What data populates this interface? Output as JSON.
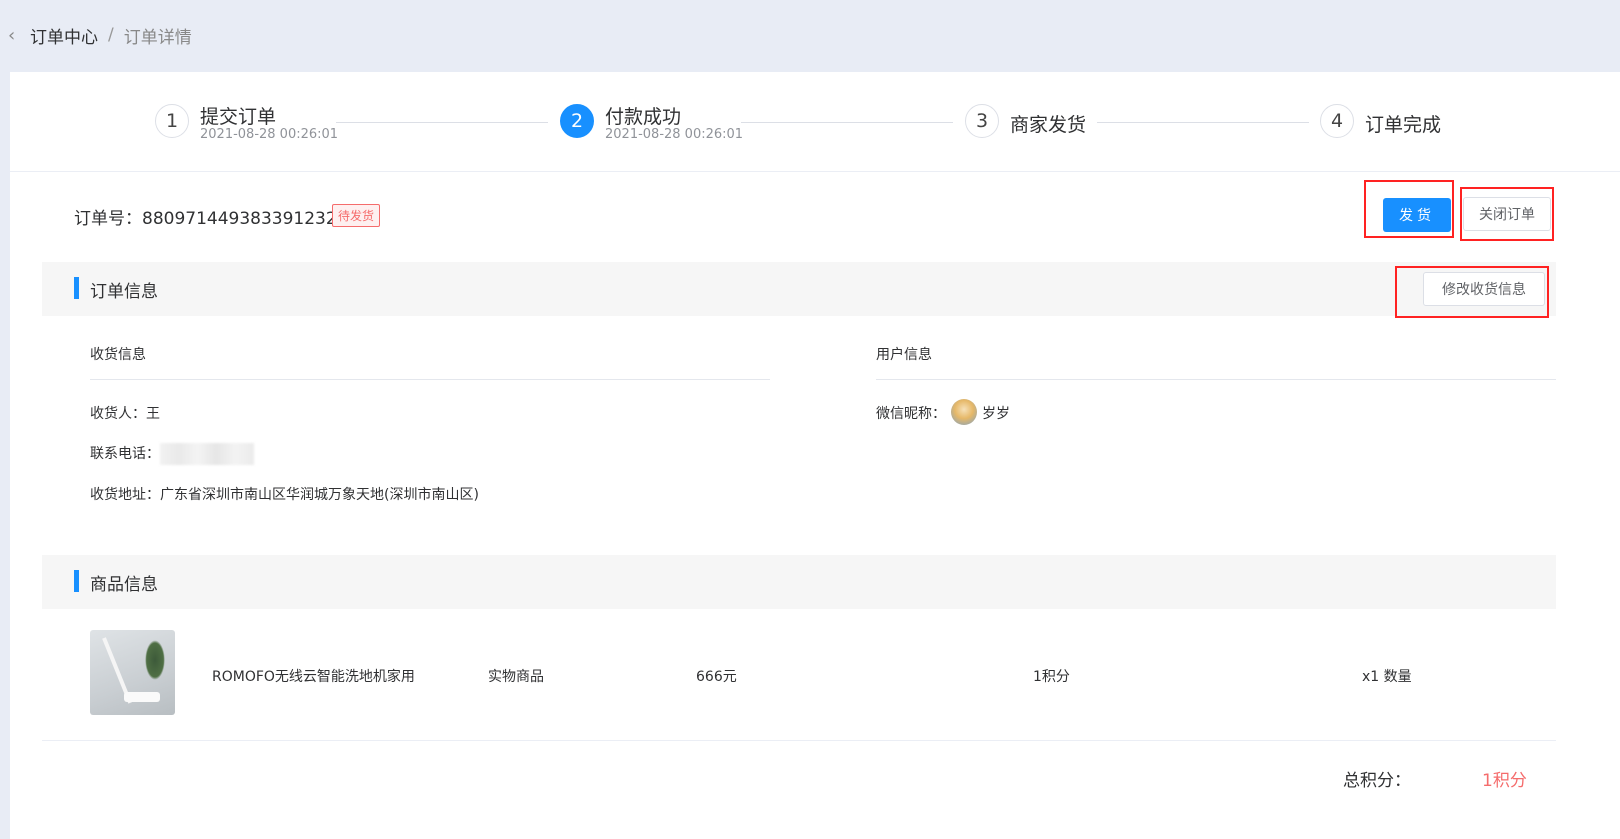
{
  "breadcrumb": {
    "back_icon": "‹",
    "home": "订单中心",
    "separator": "/",
    "current": "订单详情"
  },
  "steps": [
    {
      "num": "1",
      "title": "提交订单",
      "time": "2021-08-28 00:26:01",
      "active": false
    },
    {
      "num": "2",
      "title": "付款成功",
      "time": "2021-08-28 00:26:01",
      "active": true
    },
    {
      "num": "3",
      "title": "商家发货",
      "time": "",
      "active": false
    },
    {
      "num": "4",
      "title": "订单完成",
      "time": "",
      "active": false
    }
  ],
  "order": {
    "label": "订单号：880971449383391232",
    "status": "待发货"
  },
  "actions": {
    "ship": "发货",
    "close": "关闭订单",
    "edit_address": "修改收货信息"
  },
  "order_info": {
    "title": "订单信息",
    "shipping_title": "收货信息",
    "receiver": "收货人：王",
    "phone_label": "联系电话：",
    "address": "收货地址：广东省深圳市南山区华润城万象天地(深圳市南山区)",
    "user_title": "用户信息",
    "wechat_label": "微信昵称：",
    "wechat_nick": "岁岁"
  },
  "product_info": {
    "title": "商品信息",
    "items": [
      {
        "name": "ROMOFO无线云智能洗地机家用",
        "type": "实物商品",
        "price": "666元",
        "points": "1积分",
        "qty": "x1 数量"
      }
    ]
  },
  "total": {
    "label": "总积分：",
    "value": "1积分"
  },
  "colors": {
    "primary": "#1890ff",
    "danger": "#f56c6c",
    "highlight_box": "#ff2222"
  }
}
